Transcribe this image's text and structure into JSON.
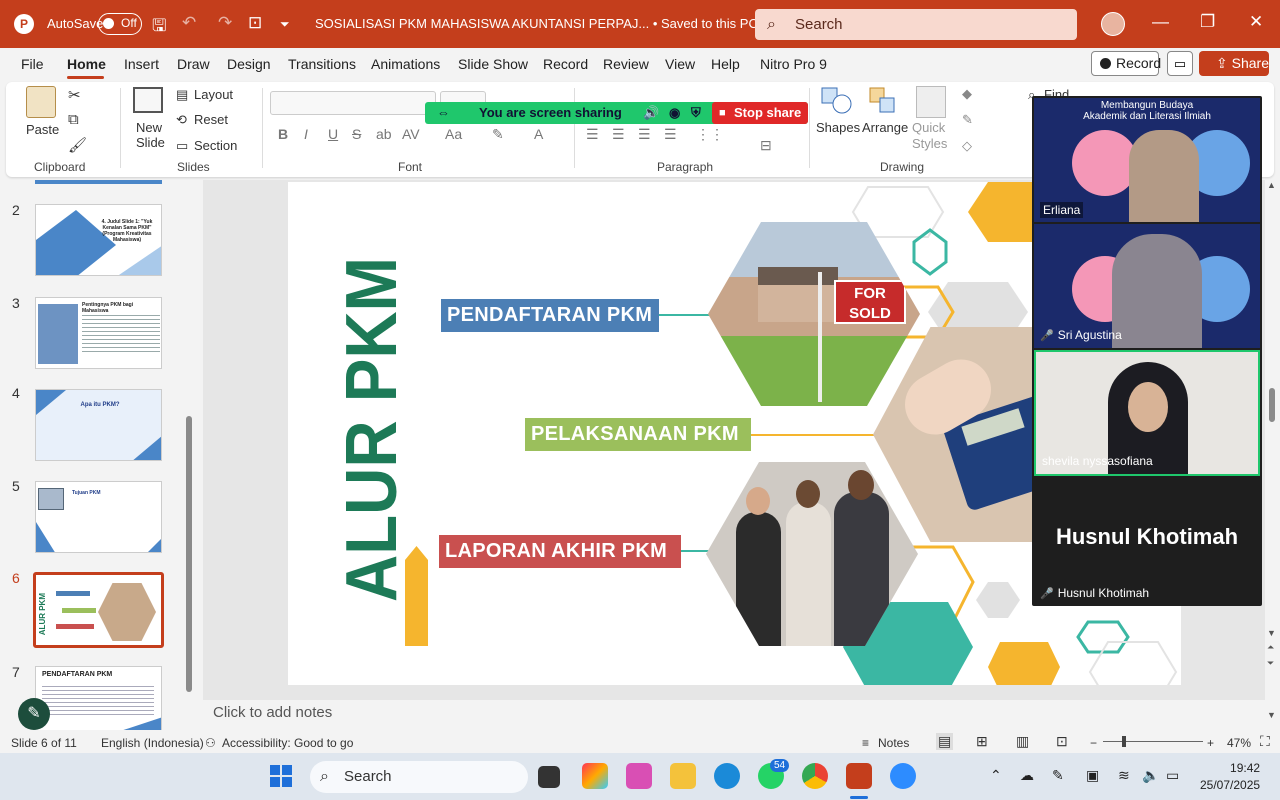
{
  "titlebar": {
    "autosave_label": "AutoSave",
    "autosave_state": "Off",
    "doc_title": "SOSIALISASI PKM MAHASISWA AKUNTANSI PERPAJ...  •  Saved to this PC  ⌄",
    "search_placeholder": "Search"
  },
  "menu": {
    "items": [
      "File",
      "Home",
      "Insert",
      "Draw",
      "Design",
      "Transitions",
      "Animations",
      "Slide Show",
      "Record",
      "Review",
      "View",
      "Help",
      "Nitro Pro 9"
    ],
    "active": "Home",
    "record_label": "Record",
    "share_label": "Share"
  },
  "ribbon": {
    "paste": "Paste",
    "clipboard_group": "Clipboard",
    "new_slide": "New\nSlide",
    "layout": "Layout",
    "reset": "Reset",
    "section": "Section",
    "slides_group": "Slides",
    "font_group": "Font",
    "paragraph_group": "Paragraph",
    "shapes": "Shapes",
    "arrange": "Arrange",
    "quick_styles": "Quick\nStyles",
    "drawing_group": "Drawing",
    "find": "Find"
  },
  "screen_share": {
    "message": "You are screen sharing",
    "stop_label": "Stop share",
    "bar_color": "#1fc76c",
    "stop_color": "#e02828"
  },
  "thumbnails": [
    {
      "num": "2",
      "title": "4. Judul Slide 1: \"Yuk Kenalan Sama PKM\" (Program Kreativitas Mahasiswa)"
    },
    {
      "num": "3",
      "title": "Pentingnya PKM bagi Mahasiswa"
    },
    {
      "num": "4",
      "title": "Apa itu PKM?"
    },
    {
      "num": "5",
      "title": "Tujuan PKM"
    },
    {
      "num": "6",
      "title": "ALUR PKM"
    },
    {
      "num": "7",
      "title": "PENDAFTARAN PKM"
    }
  ],
  "slide": {
    "vertical_title": "ALUR PKM",
    "steps": [
      {
        "label": "PENDAFTARAN PKM",
        "color": "#4c7fb5"
      },
      {
        "label": "PELAKSANAAN PKM",
        "color": "#9bbf5c"
      },
      {
        "label": "LAPORAN AKHIR PKM",
        "color": "#c9504f"
      }
    ],
    "title_color": "#1d7a57",
    "accent_teal": "#3bb7a3",
    "accent_gold": "#f5b52e",
    "sold_sign": "FOR SOLD"
  },
  "notes_placeholder": "Click to add notes",
  "video": {
    "banner_line1": "Membangun Budaya",
    "banner_line2": "Akademik dan Literasi Ilmiah",
    "participants": [
      {
        "name": "Erliana",
        "muted": false
      },
      {
        "name": "Sri Agustina",
        "muted": true
      },
      {
        "name": "shevila nyssasofiana",
        "muted": false
      },
      {
        "name": "Husnul Khotimah",
        "muted": true
      }
    ],
    "big_name": "Husnul Khotimah"
  },
  "status": {
    "slide_info": "Slide 6 of 11",
    "language": "English (Indonesia)",
    "accessibility": "Accessibility: Good to go",
    "notes": "Notes",
    "zoom": "47%"
  },
  "taskbar": {
    "search": "Search",
    "whatsapp_badge": "54",
    "time": "19:42",
    "date": "25/07/2025"
  }
}
